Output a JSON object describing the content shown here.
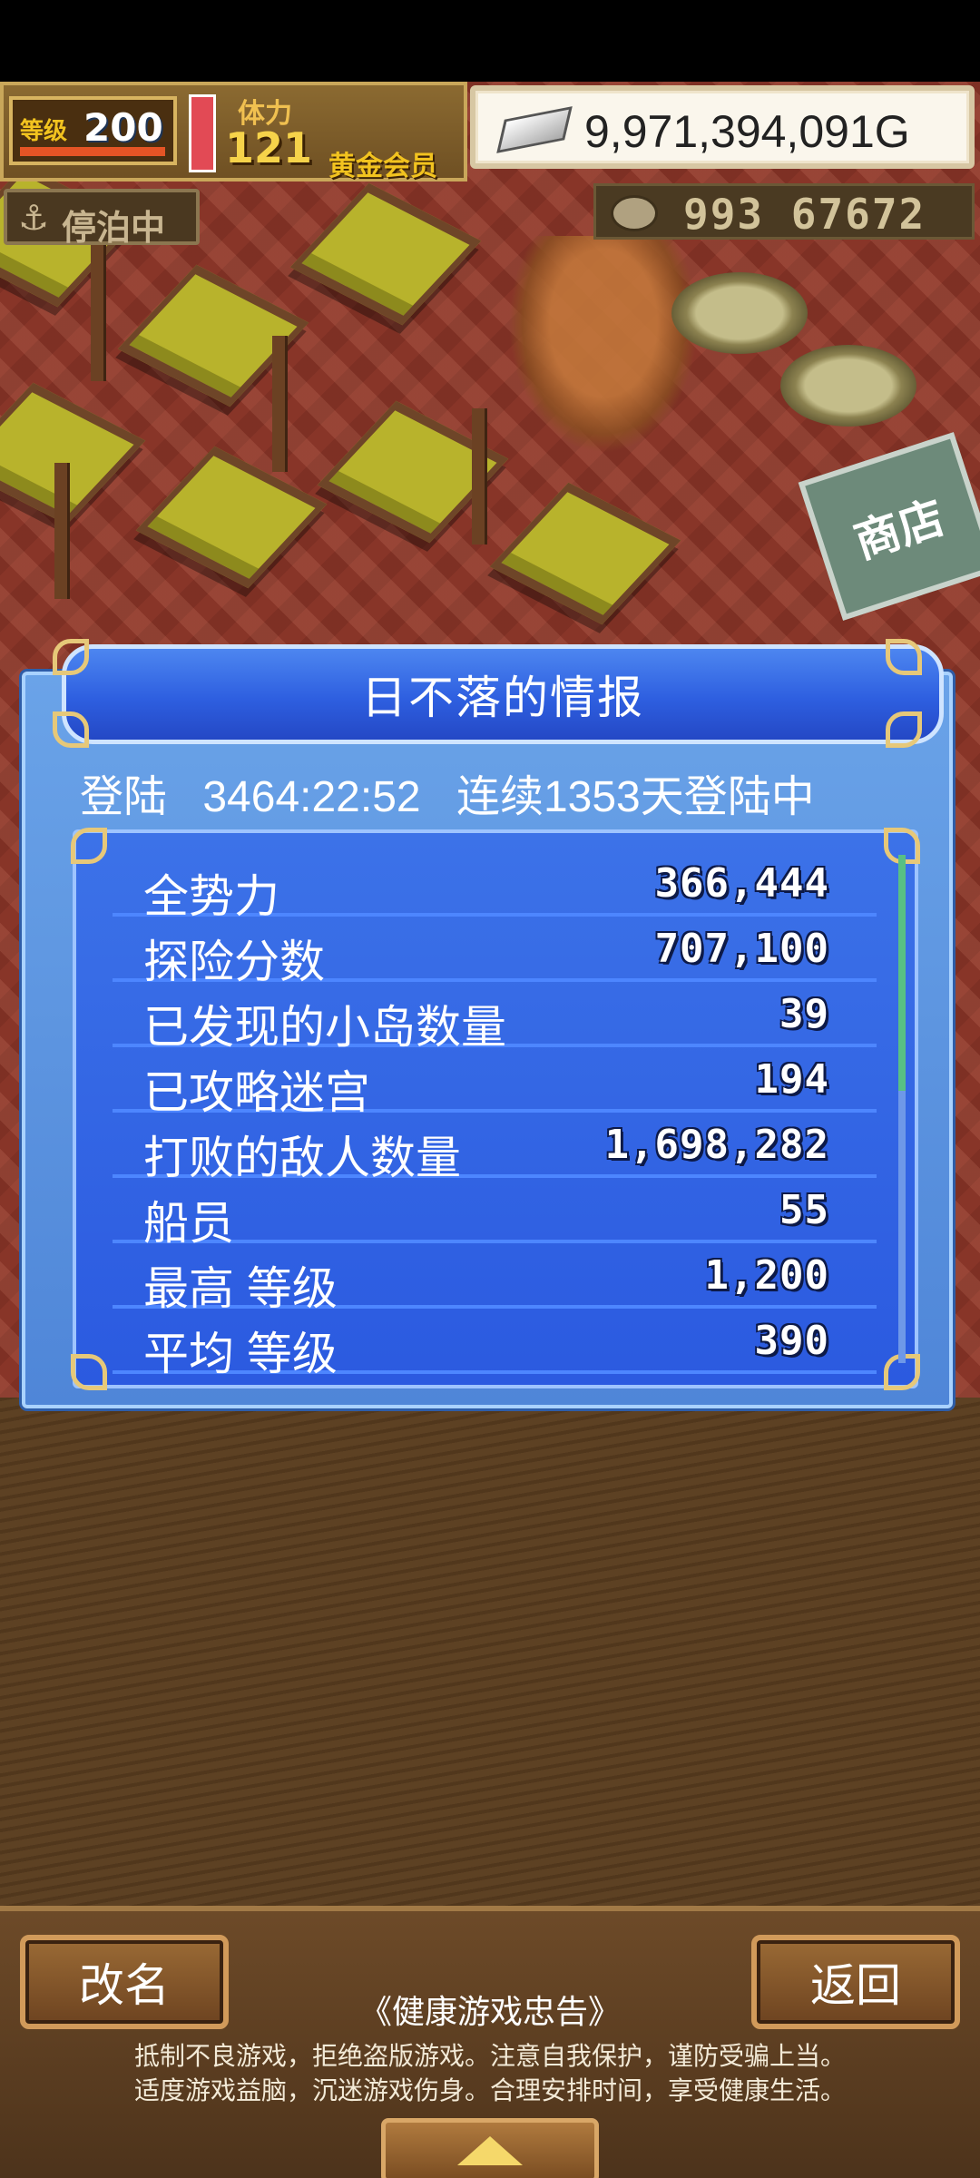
{
  "hud": {
    "level_label": "等级",
    "level_value": "200",
    "stamina_label": "体力",
    "stamina_value": "121",
    "member_label": "黄金会员",
    "gold": "9,971,394,091G",
    "dock_status": "停泊中",
    "tickets": "993 67672"
  },
  "panel": {
    "title": "日不落的情报",
    "login_label": "登陆",
    "login_time": "3464:22:52",
    "streak": "连续1353天登陆中",
    "stats": [
      {
        "label": "全势力",
        "value": "366,444"
      },
      {
        "label": "探险分数",
        "value": "707,100"
      },
      {
        "label": "已发现的小岛数量",
        "value": "39"
      },
      {
        "label": "已攻略迷宫",
        "value": "194"
      },
      {
        "label": "打败的敌人数量",
        "value": "1,698,282"
      },
      {
        "label": "船员",
        "value": "55"
      },
      {
        "label": "最高 等级",
        "value": "1,200"
      },
      {
        "label": "平均 等级",
        "value": "390"
      }
    ]
  },
  "bottom": {
    "rename_label": "改名",
    "back_label": "返回",
    "notice_title": "《健康游戏忠告》",
    "notice_line1": "抵制不良游戏，拒绝盗版游戏。注意自我保护，谨防受骗上当。",
    "notice_line2": "适度游戏益脑，沉迷游戏伤身。合理安排时间，享受健康生活。"
  },
  "icons": {
    "anchor": "anchor-icon",
    "silver": "silver-bar-icon",
    "ticket": "ticket-icon",
    "expand": "arrow-up-icon"
  },
  "colors": {
    "panel_blue": "#3c72e8",
    "title_blue": "#2e5fe0",
    "wood": "#6d4a28"
  }
}
